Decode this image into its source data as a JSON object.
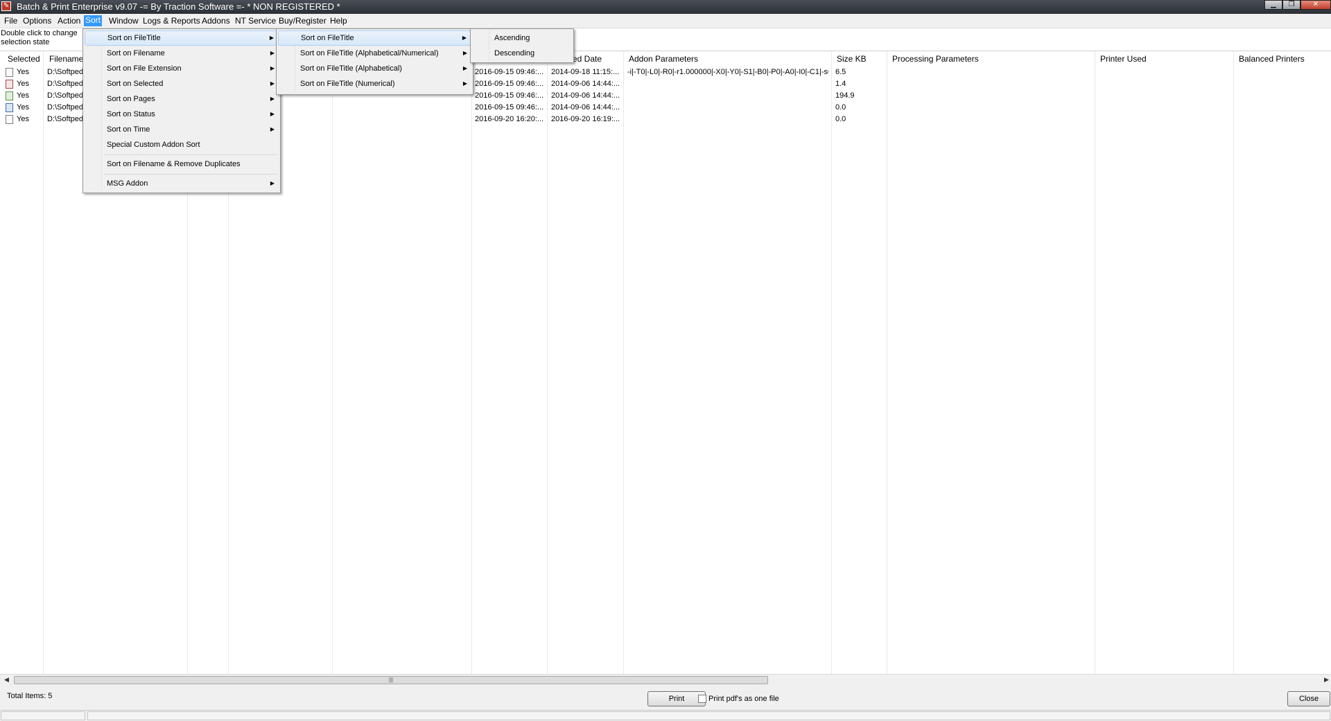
{
  "window": {
    "title": "Batch & Print Enterprise v9.07 -= By Traction Software =- * NON REGISTERED *",
    "controls": {
      "minimize": "▁",
      "maximize": "❐",
      "close": "✕"
    }
  },
  "menubar": [
    "File",
    "Options",
    "Action",
    "Sort",
    "Window",
    "Logs & Reports",
    "Addons",
    "NT Service",
    "Buy/Register",
    "Help"
  ],
  "hint": "Double click to change selection state",
  "table": {
    "columns": [
      "Selected",
      "Filename",
      "ed Date",
      "Addon Parameters",
      "Size KB",
      "Processing Parameters",
      "Printer Used",
      "Balanced Printers"
    ],
    "rows": [
      {
        "icon": "image-file-icon",
        "selected": "Yes",
        "filename": "D:\\Softped",
        "date1": "2016-09-15 09:46:...",
        "date2": "2014-09-18 11:15:...",
        "addon": "-i|-T0|-L0|-R0|-r1.000000|-X0|-Y0|-S1|-B0|-P0|-A0|-I0|-C1|-s0|-e...",
        "size": "6.5"
      },
      {
        "icon": "pdf-file-icon",
        "selected": "Yes",
        "filename": "D:\\Softped",
        "date1": "2016-09-15 09:46:...",
        "date2": "2014-09-06 14:44:...",
        "addon": "",
        "size": "1.4"
      },
      {
        "icon": "xls-file-icon",
        "selected": "Yes",
        "filename": "D:\\Softped",
        "date1": "2016-09-15 09:46:...",
        "date2": "2014-09-06 14:44:...",
        "addon": "",
        "size": "194.9"
      },
      {
        "icon": "doc-file-icon",
        "selected": "Yes",
        "filename": "D:\\Softped",
        "date1": "2016-09-15 09:46:...",
        "date2": "2014-09-06 14:44:...",
        "addon": "",
        "size": "0.0"
      },
      {
        "icon": "blank-file-icon",
        "selected": "Yes",
        "filename": "D:\\Softped",
        "date1": "2016-09-20 16:20:...",
        "date2": "2016-09-20 16:19:...",
        "addon": "",
        "size": "0.0"
      }
    ]
  },
  "sort_menu": {
    "items": [
      {
        "label": "Sort on FileTitle",
        "submenu": true
      },
      {
        "label": "Sort on Filename",
        "submenu": true
      },
      {
        "label": "Sort on File Extension",
        "submenu": true
      },
      {
        "label": "Sort on Selected",
        "submenu": true
      },
      {
        "label": "Sort on Pages",
        "submenu": true
      },
      {
        "label": "Sort on Status",
        "submenu": true
      },
      {
        "label": "Sort on Time",
        "submenu": true
      },
      {
        "label": "Special Custom Addon Sort",
        "submenu": false
      },
      {
        "label": "Sort on Filename & Remove Duplicates",
        "submenu": false
      },
      {
        "label": "MSG Addon",
        "submenu": true
      }
    ]
  },
  "filetitle_menu": {
    "items": [
      {
        "label": "Sort on FileTitle"
      },
      {
        "label": "Sort on FileTitle (Alphabetical/Numerical)"
      },
      {
        "label": "Sort on FileTitle (Alphabetical)"
      },
      {
        "label": "Sort on FileTitle (Numerical)"
      }
    ]
  },
  "order_menu": {
    "items": [
      "Ascending",
      "Descending"
    ]
  },
  "footer": {
    "total_items": "Total Items:  5",
    "print_label": "Print",
    "print_one_file_label": "Print pdf's as one file",
    "close_label": "Close"
  },
  "arrow_glyph": "▶",
  "colors": {
    "menu_highlight": "#3399ff",
    "item_hover": "#d9e8f9"
  }
}
